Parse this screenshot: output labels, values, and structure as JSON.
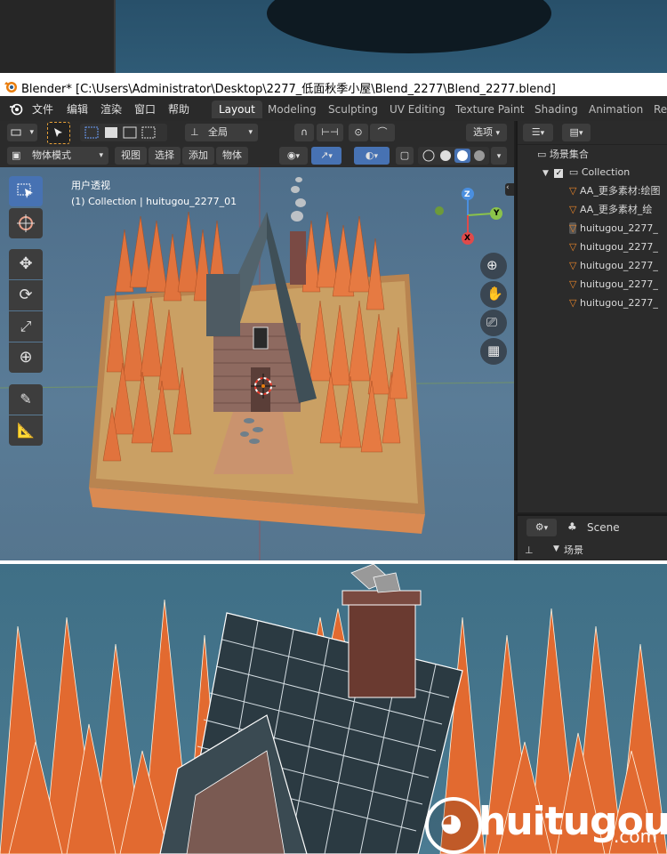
{
  "window": {
    "title": "Blender* [C:\\Users\\Administrator\\Desktop\\2277_低面秋季小屋\\Blend_2277\\Blend_2277.blend]"
  },
  "menubar": {
    "items": [
      "文件",
      "编辑",
      "渲染",
      "窗口",
      "帮助"
    ]
  },
  "workspace_tabs": [
    "Layout",
    "Modeling",
    "Sculpting",
    "UV Editing",
    "Texture Paint",
    "Shading",
    "Animation",
    "Re"
  ],
  "active_tab": "Layout",
  "viewport_header": {
    "transform_orientation": "全局",
    "options_label": "选项",
    "mode": "物体模式",
    "menus": [
      "视图",
      "选择",
      "添加",
      "物体"
    ]
  },
  "viewport": {
    "view_name": "用户透视",
    "collection_info": "(1) Collection | huitugou_2277_01",
    "gizmo_axes": {
      "x": "X",
      "y": "Y",
      "z": "Z"
    }
  },
  "outliner": {
    "scene_collection": "场景集合",
    "collection": "Collection",
    "objects": [
      "AA_更多素材:绘图",
      "AA_更多素材_绘",
      "huitugou_2277_",
      "huitugou_2277_",
      "huitugou_2277_",
      "huitugou_2277_",
      "huitugou_2277_"
    ]
  },
  "properties": {
    "scene_label": "Scene",
    "section": "场景"
  },
  "watermark": {
    "brand": "huitugou",
    "suffix": ".com"
  },
  "colors": {
    "accent": "#4772b3",
    "active_tab": "#3d3d3d",
    "tree_orange": "#e0703a",
    "ground_sand": "#c99555",
    "roof": "#4a5860"
  }
}
